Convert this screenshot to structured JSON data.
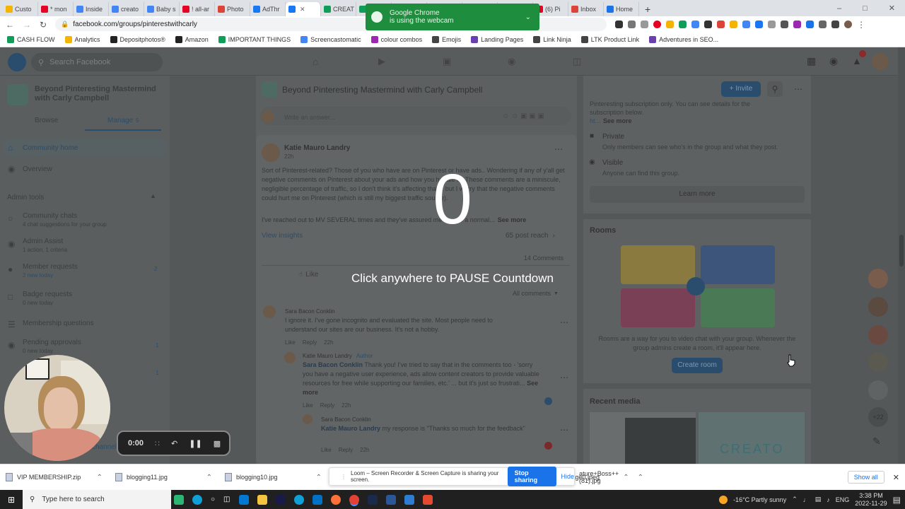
{
  "browser": {
    "tabs": [
      "Custo",
      "* mon",
      "Inside",
      "creato",
      "Baby s",
      "! all-ar",
      "Photo",
      "AdThr",
      "",
      "CREAT",
      "",
      "RANK",
      "(6) Pi",
      "(6) Pi",
      "(4) Pi",
      "(6) Pi",
      "Inbox",
      "Home"
    ],
    "url": "facebook.com/groups/pinterestwithcarly",
    "bookmarks": [
      "CASH FLOW",
      "Analytics",
      "Depositphotos®",
      "Amazon",
      "IMPORTANT THINGS",
      "Screencastomatic",
      "colour combos",
      "Emojis",
      "Landing Pages",
      "Link Ninja",
      "LTK Product Link",
      "Adventures in SEO..."
    ]
  },
  "notification": {
    "title": "Google Chrome",
    "text": "is using the webcam"
  },
  "facebook": {
    "search_placeholder": "Search Facebook",
    "group_name": "Beyond Pinteresting Mastermind with Carly Campbell",
    "tab_browse": "Browse",
    "tab_manage": "Manage",
    "tab_manage_count": "5",
    "nav_community_home": "Community home",
    "nav_overview": "Overview",
    "admin_tools": "Admin tools",
    "community_chats": "Community chats",
    "community_chats_sub": "4 chat suggestions for your group",
    "admin_assist": "Admin Assist",
    "admin_assist_sub": "1 action, 1 criteria",
    "member_requests": "Member requests",
    "member_requests_sub": "2 new today",
    "member_requests_count": "2",
    "badge_requests": "Badge requests",
    "badge_requests_sub": "0 new today",
    "membership_questions": "Membership questions",
    "pending_approvals": "Pending approvals",
    "pending_approvals_sub": "0 new today",
    "pending_approvals_count": "1",
    "left_extra_count": "1",
    "channel_fragment": "channel",
    "center_header": "Beyond Pinteresting Mastermind with Carly Campbell",
    "answer_placeholder": "Write an answer...",
    "post_author": "Katie Mauro Landry",
    "post_time": "22h",
    "post_text": "Sort of Pinterest-related? Those of you who have are on Pinterest or have ads.. Wondering if any of y'all get negative comments on Pinterest about your ads and how you handle it? These comments are a miniscule, negligible percentage of traffic, so I don't think it's affecting that... but I worry that the negative comments could hurt me on Pinterest (which is still my biggest traffic source).",
    "post_text2": "I've reached out to MV SEVERAL times and they've assured me I am in a normal...",
    "see_more": "See more",
    "view_insights": "View insights",
    "post_reach": "65 post reach",
    "comments_count": "14 Comments",
    "like": "Like",
    "all_comments": "All comments",
    "c1_author": "Sara Bacon Conklin",
    "c1_text": "I ignore it. I've gone incognito and evaluated the site. Most people need to understand our sites are our business. It's not a hobby.",
    "c1_like": "Like",
    "c1_reply": "Reply",
    "c1_time": "22h",
    "c2_author": "Katie Mauro Landry",
    "c2_badge": "Author",
    "c2_mention": "Sara Bacon Conklin",
    "c2_text": " Thank you! I've tried to say that in the comments too - 'sorry you have a negative user experience, ads allow content creators to provide valuable resources for free while supporting our families, etc.' ... but it's just so frustrati...",
    "c2_see_more": "See more",
    "c2_like": "Like",
    "c2_reply": "Reply",
    "c2_time": "22h",
    "c3_author": "Sara Bacon Conklin",
    "c3_mention": "Katie Mauro Landry",
    "c3_text": " my response is \"Thanks so much for the feedback\"",
    "c3_like": "Like",
    "c3_reply": "Reply",
    "c3_time": "22h",
    "invite": "+ Invite",
    "about_text": "Pinteresting subscription only. You can see details for the subscription below.",
    "about_ht": "ht...",
    "about_see_more": "See more",
    "private_title": "Private",
    "private_text": "Only members can see who's in the group and what they post.",
    "visible_title": "Visible",
    "visible_text": "Anyone can find this group.",
    "learn_more": "Learn more",
    "rooms_title": "Rooms",
    "rooms_text": "Rooms are a way for you to video chat with your group. Whenever the group admins create a room, it'll appear here.",
    "create_room": "Create room",
    "recent_media": "Recent media",
    "media_fragment": "CREATO",
    "contacts_more": "+22"
  },
  "overlay": {
    "countdown": "0",
    "message": "Click anywhere to PAUSE Countdown"
  },
  "loom": {
    "timer": "0:00",
    "share_text": "Loom – Screen Recorder & Screen Capture is sharing your screen.",
    "stop": "Stop sharing",
    "hide": "Hide"
  },
  "downloads": {
    "items": [
      "VIP MEMBERSHIP.zip",
      "blogging11.jpg",
      "blogging10.jpg",
      "ature+Boss++(81).jpg",
      "image0.jpeg"
    ],
    "show_all": "Show all"
  },
  "taskbar": {
    "search": "Type here to search",
    "weather": "-16°C  Partly sunny",
    "lang": "ENG",
    "time": "3:38 PM",
    "date": "2022-11-29"
  },
  "colors": {
    "chrome_green": "#1e8e3e",
    "fb_blue": "#1877f2",
    "stop_blue": "#1a73e8"
  }
}
